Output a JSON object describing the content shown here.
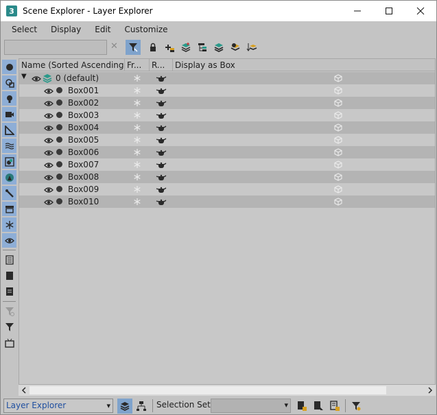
{
  "window": {
    "title": "Scene Explorer - Layer Explorer",
    "logo_glyph": "3",
    "minimize_glyph": "—",
    "maximize_glyph": "☐",
    "close_glyph": "✕"
  },
  "menu": {
    "items": [
      "Select",
      "Display",
      "Edit",
      "Customize"
    ]
  },
  "search": {
    "value": "",
    "clear_glyph": "✕"
  },
  "toolbar_icons": [
    "filter-icon",
    "lock-icon",
    "add-to-layer-icon",
    "create-layer-icon",
    "hierarchy-icon",
    "layers-icon",
    "highlight-layer-icon",
    "sort-layer-icon"
  ],
  "sidebar_icons": [
    "geometry-icon",
    "shapes-icon",
    "lights-icon",
    "cameras-icon",
    "helpers-icon",
    "space-warps-icon",
    "groups-icon",
    "xrefs-icon",
    "bones-icon",
    "containers-icon",
    "frozen-icon",
    "hidden-icon",
    "all-icon",
    "none-icon",
    "invert-icon",
    "filter-display-icon",
    "selection-filter-icon",
    "pin-icon"
  ],
  "columns": {
    "name": "Name (Sorted Ascending)",
    "sort_arrow": "▲",
    "frozen": "Fr...",
    "render": "R...",
    "display_as_box": "Display as Box"
  },
  "layer": {
    "name": "0 (default)",
    "expand_glyph": "▼"
  },
  "objects": [
    "Box001",
    "Box002",
    "Box003",
    "Box004",
    "Box005",
    "Box006",
    "Box007",
    "Box008",
    "Box009",
    "Box010"
  ],
  "status": {
    "explorer_name": "Layer Explorer",
    "selection_set_label": "Selection Set:",
    "dropdown_arrow": "▾"
  },
  "colors": {
    "accent": "#7fa3cc",
    "row_shade": "#b4b4b4",
    "layer_text": "#1f4fa0"
  }
}
